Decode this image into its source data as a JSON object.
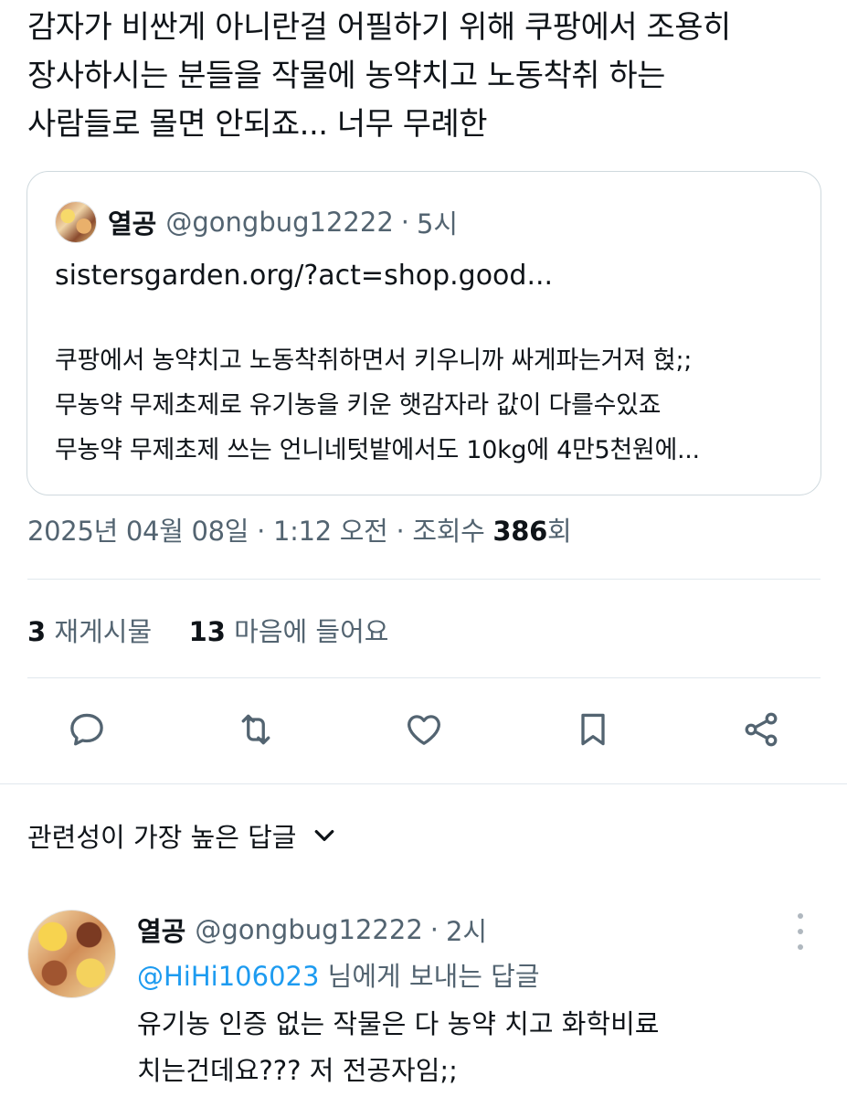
{
  "tweet": {
    "lines": [
      "감자가 비싼게 아니란걸 어필하기 위해 쿠팡에서 조용히",
      "장사하시는 분들을 작물에 농약치고 노동착취 하는",
      "사람들로 몰면 안되죠... 너무 무례한"
    ]
  },
  "quote": {
    "name": "열공",
    "handle": "@gongbug12222",
    "dot": "·",
    "time": "5시",
    "url": "sistersgarden.org/?act=shop.good...",
    "body_lines": [
      "쿠팡에서 농약치고 노동착취하면서 키우니까 싸게파는거져 헍;;",
      "무농약 무제초제로 유기농을 키운 햇감자라 값이 다를수있죠",
      "무농약 무제초제 쓰는 언니네텃밭에서도 10kg에 4만5천원에..."
    ]
  },
  "meta": {
    "date": "2025년 04월 08일",
    "dot1": "·",
    "time": "1:12 오전",
    "dot2": "·",
    "views_label": "조회수",
    "views_count": "386",
    "views_suffix": "회"
  },
  "stats": {
    "reposts_count": "3",
    "reposts_label": "재게시물",
    "likes_count": "13",
    "likes_label": "마음에 들어요"
  },
  "icons": {
    "reply": "reply-icon",
    "retweet": "retweet-icon",
    "like": "heart-icon",
    "bookmark": "bookmark-icon",
    "share": "share-icon",
    "sort_chevron": "chevron-down-icon",
    "more": "more-vertical-icon"
  },
  "sort": {
    "label": "관련성이 가장 높은 답글"
  },
  "reply": {
    "name": "열공",
    "handle": "@gongbug12222",
    "dot": "·",
    "time": "2시",
    "mention": "@HiHi106023",
    "replyto_suffix": " 님에게 보내는 답글",
    "body_lines": [
      "유기농 인증 없는 작물은 다 농약 치고 화학비료",
      "치는건데요??? 저 전공자임;;"
    ]
  },
  "colors": {
    "text": "#0f1419",
    "secondary": "#536471",
    "border": "#cfd9de",
    "link": "#1d9bf0"
  }
}
